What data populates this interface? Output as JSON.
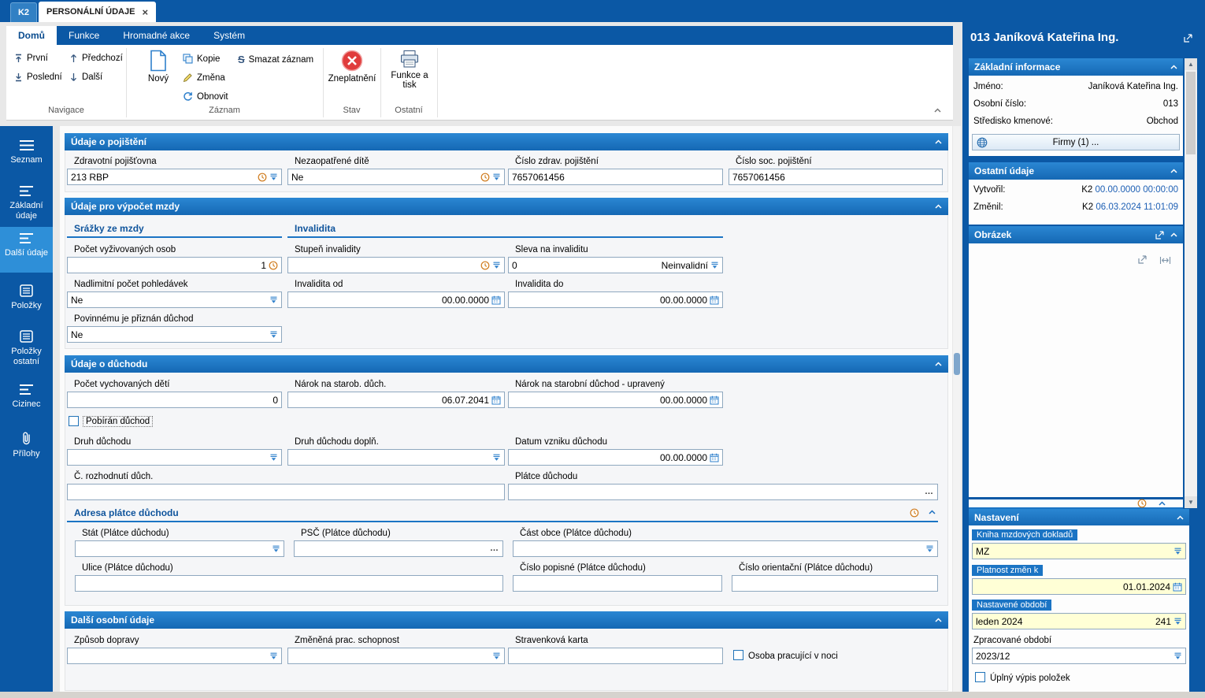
{
  "colors": {
    "accent_blue": "#0b58a5",
    "section_header_blue": "#1f7ac9",
    "active_sidebar_blue": "#2e8fd8",
    "field_yellow": "#ffffd6",
    "invalidate_red": "#e03c3c",
    "value_blue": "#1d5fb4"
  },
  "icons": {
    "clock-icon": "◷",
    "dropdown-icon": "⏷",
    "calendar-icon": "▦",
    "ellipsis-button": "…",
    "chevron-up-icon": "∧",
    "close-icon": "×",
    "globe-icon": "◍",
    "paperclip-icon": "🖇",
    "printer-icon": "⎙",
    "new-document-icon": "🗋",
    "copy-icon": "⧉",
    "edit-icon": "✎",
    "refresh-icon": "↻",
    "invalidate-icon": "⊗",
    "first-record-icon": "⤒",
    "last-record-icon": "⤓",
    "prev-record-icon": "↑",
    "next-record-icon": "↓",
    "popout-icon": "↗",
    "fit-width-icon": "↔",
    "menu-icon": "☰",
    "scroll-up-icon": "▲",
    "scroll-down-icon": "▼"
  },
  "window": {
    "app_tab": "K2",
    "doc_tab": "PERSONÁLNÍ ÚDAJE",
    "close": "×"
  },
  "ribbon": {
    "tabs": [
      "Domů",
      "Funkce",
      "Hromadné akce",
      "Systém"
    ],
    "navigace": {
      "label": "Navigace",
      "prvni": "První",
      "posledni": "Poslední",
      "predchozi": "Předchozí",
      "dalsi": "Další"
    },
    "zaznam": {
      "label": "Záznam",
      "novy": "Nový",
      "kop": "Kopie",
      "zmena": "Změna",
      "obnovit": "Obnovit",
      "smazat": "Smazat záznam",
      "smazat_icon": "S"
    },
    "stav": {
      "label": "Stav",
      "zneplatneni": "Zneplatnění"
    },
    "ostatni": {
      "label": "Ostatní",
      "funkce_tisk": "Funkce a tisk"
    }
  },
  "sidebar": {
    "items": [
      "Seznam",
      "Základní údaje",
      "Další údaje",
      "Položky",
      "Položky ostatní",
      "Cizinec",
      "Přílohy"
    ]
  },
  "pojisteni": {
    "title": "Údaje o pojištění",
    "zdravotni": {
      "label": "Zdravotní pojišťovna",
      "value": "213 RBP"
    },
    "dite": {
      "label": "Nezaopatřené dítě",
      "value": "Ne"
    },
    "cislo_zdrav": {
      "label": "Číslo zdrav. pojištění",
      "value": "7657061456"
    },
    "cislo_soc": {
      "label": "Číslo soc. pojištění",
      "value": "7657061456"
    }
  },
  "vypocet": {
    "title": "Údaje pro výpočet mzdy",
    "srazky_title": "Srážky ze mzdy",
    "invalidita_title": "Invalidita",
    "pocet_osob": {
      "label": "Počet vyživovaných osob",
      "value": "1"
    },
    "stupen": {
      "label": "Stupeň invalidity",
      "value": ""
    },
    "sleva": {
      "label": "Sleva na invaliditu",
      "value": "0",
      "status": "Neinvalidní"
    },
    "nadlimitni": {
      "label": "Nadlimitní počet pohledávek",
      "value": "Ne"
    },
    "inv_od": {
      "label": "Invalidita od",
      "value": "00.00.0000"
    },
    "inv_do": {
      "label": "Invalidita do",
      "value": "00.00.0000"
    },
    "priznan": {
      "label": "Povinnému je přiznán důchod",
      "value": "Ne"
    }
  },
  "duchod": {
    "title": "Údaje o důchodu",
    "pocet_deti": {
      "label": "Počet vychovaných dětí",
      "value": "0"
    },
    "narok": {
      "label": "Nárok na starob. důch.",
      "value": "06.07.2041"
    },
    "narok_upr": {
      "label": "Nárok na starobní důchod - upravený",
      "value": "00.00.0000"
    },
    "pobiran": "Pobírán důchod",
    "druh": {
      "label": "Druh důchodu",
      "value": ""
    },
    "druh_dopln": {
      "label": "Druh důchodu doplň.",
      "value": ""
    },
    "datum_vzniku": {
      "label": "Datum vzniku důchodu",
      "value": "00.00.0000"
    },
    "rozhodnuti": {
      "label": "Č. rozhodnutí důch.",
      "value": ""
    },
    "platce": {
      "label": "Plátce důchodu",
      "value": ""
    },
    "adresa_title": "Adresa plátce důchodu",
    "stat": {
      "label": "Stát (Plátce důchodu)",
      "value": ""
    },
    "psc": {
      "label": "PSČ (Plátce důchodu)",
      "value": ""
    },
    "cast_obce": {
      "label": "Část obce (Plátce důchodu)",
      "value": ""
    },
    "ulice": {
      "label": "Ulice (Plátce důchodu)",
      "value": ""
    },
    "cislo_popisne": {
      "label": "Číslo popisné (Plátce důchodu)",
      "value": ""
    },
    "cislo_orient": {
      "label": "Číslo orientační (Plátce důchodu)",
      "value": ""
    }
  },
  "dalsi_udaje": {
    "title": "Další osobní údaje",
    "doprava": {
      "label": "Způsob dopravy",
      "value": ""
    },
    "zmenena": {
      "label": "Změněná prac. schopnost",
      "value": ""
    },
    "stravenka": {
      "label": "Stravenková karta",
      "value": ""
    },
    "noc": "Osoba pracující v noci"
  },
  "person": {
    "header": "013 Janíková Kateřina Ing.",
    "zakladni": {
      "title": "Základní informace",
      "jmeno": {
        "label": "Jméno:",
        "value": "Janíková Kateřina Ing."
      },
      "osobni_cislo": {
        "label": "Osobní číslo:",
        "value": "013"
      },
      "stredisko": {
        "label": "Středisko kmenové:",
        "value": "Obchod"
      },
      "firmy": "Firmy (1) ..."
    },
    "ostatni": {
      "title": "Ostatní údaje",
      "vytvoril": {
        "label": "Vytvořil:",
        "user": "K2",
        "value": "00.00.0000 00:00:00"
      },
      "zmenil": {
        "label": "Změnil:",
        "user": "K2",
        "value": "06.03.2024 11:01:09"
      }
    },
    "obrazek": {
      "title": "Obrázek"
    }
  },
  "nastaveni": {
    "title": "Nastavení",
    "kniha": {
      "label": "Kniha mzdových dokladů",
      "value": "MZ"
    },
    "platnost": {
      "label": "Platnost změn k",
      "value": "01.01.2024"
    },
    "obdobi": {
      "label": "Nastavené období",
      "value": "leden 2024",
      "number": "241"
    },
    "zpracovane": {
      "label": "Zpracované období",
      "value": "2023/12"
    },
    "uplny_vypis": "Úplný výpis položek"
  }
}
